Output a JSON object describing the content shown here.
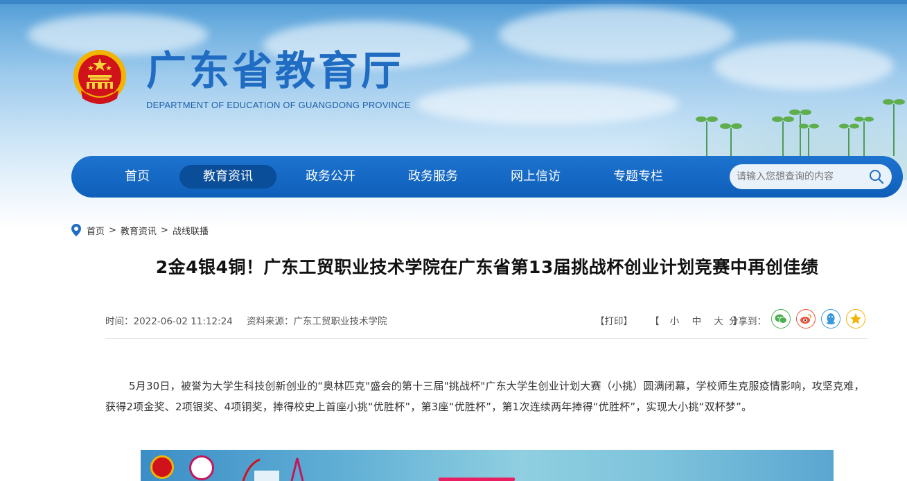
{
  "header": {
    "title": "广东省教育厅",
    "subtitle": "DEPARTMENT OF EDUCATION OF GUANGDONG PROVINCE"
  },
  "nav": {
    "items": [
      {
        "label": "首页",
        "active": false
      },
      {
        "label": "教育资讯",
        "active": true
      },
      {
        "label": "政务公开",
        "active": false
      },
      {
        "label": "政务服务",
        "active": false
      },
      {
        "label": "网上信访",
        "active": false
      },
      {
        "label": "专题专栏",
        "active": false
      }
    ],
    "search_placeholder": "请输入您想查询的内容"
  },
  "breadcrumb": {
    "items": [
      "首页",
      "教育资讯",
      "战线联播"
    ],
    "separator": ">"
  },
  "article": {
    "title": "2金4银4铜！广东工贸职业技术学院在广东省第13届挑战杯创业计划竞赛中再创佳绩",
    "time": "时间：2022-06-02 11:12:24",
    "source": "资料来源：广东工贸职业技术学院",
    "print_label": "【打印】",
    "fontsize_open": "【",
    "fontsize_small": "小",
    "fontsize_medium": "中",
    "fontsize_large": "大",
    "fontsize_close": "】",
    "share_label": "分享到：",
    "paragraph": "5月30日，被誉为大学生科技创新创业的“奥林匹克\"盛会的第十三届\"挑战杯\"广东大学生创业计划大赛（小挑）圆满闭幕，学校师生克服疫情影响，攻坚克难，获得2项金奖、2项银奖、4项铜奖，捧得校史上首座小挑“优胜杯”，第3座“优胜杯”，第1次连续两年捧得“优胜杯”，实现大小挑“双杯梦”。"
  },
  "share_icons": [
    {
      "name": "wechat-icon",
      "color": "#4caf50"
    },
    {
      "name": "weibo-icon",
      "color": "#e8553e"
    },
    {
      "name": "qq-icon",
      "color": "#3a9ad9"
    },
    {
      "name": "qzone-icon",
      "color": "#f0b400"
    }
  ],
  "colors": {
    "brand_blue": "#1f6cc2",
    "nav_blue": "#0e5fb9",
    "nav_active": "#0a4d98"
  }
}
